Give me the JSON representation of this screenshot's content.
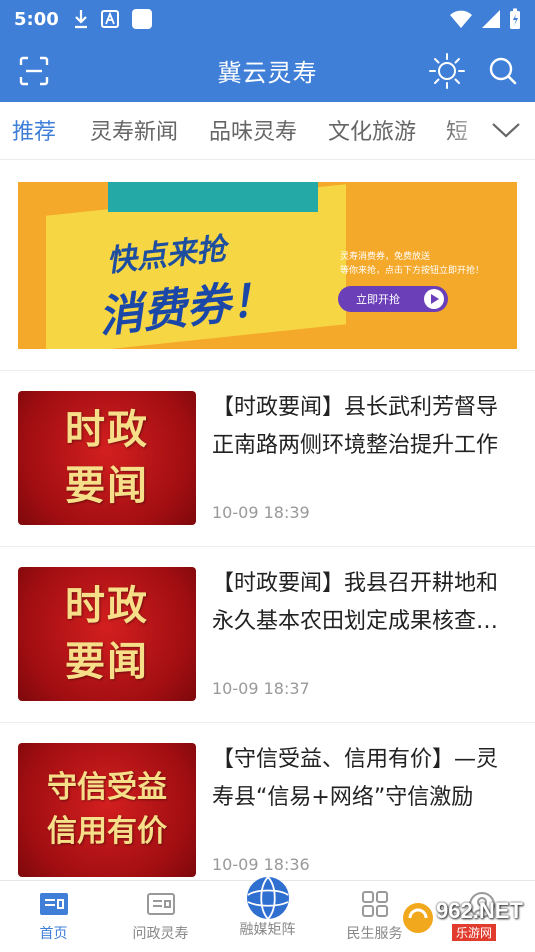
{
  "status_bar": {
    "time": "5:00"
  },
  "app_bar": {
    "title": "冀云灵寿"
  },
  "tabs": [
    {
      "label": "推荐",
      "active": true
    },
    {
      "label": "灵寿新闻",
      "active": false
    },
    {
      "label": "品味灵寿",
      "active": false
    },
    {
      "label": "文化旅游",
      "active": false
    },
    {
      "label": "短",
      "active": false
    }
  ],
  "banner": {
    "line1": "快点来抢",
    "line2": "消费券！",
    "note": "灵寿消费券，免费放送\n等你来抢，点击下方按钮立即开抢！",
    "button": "立即开抢"
  },
  "news": [
    {
      "thumb_lines": [
        "时政",
        "要闻"
      ],
      "title": "【时政要闻】县长武利芳督导正南路两侧环境整治提升工作",
      "time": "10-09 18:39"
    },
    {
      "thumb_lines": [
        "时政",
        "要闻"
      ],
      "title": "【时政要闻】我县召开耕地和永久基本农田划定成果核查工作",
      "time": "10-09 18:37"
    },
    {
      "thumb_lines": [
        "守信受益",
        "信用有价"
      ],
      "title": "【守信受益、信用有价】—灵寿县“信易+网络”守信激励",
      "time": "10-09 18:36"
    }
  ],
  "bottom_nav": [
    {
      "label": "首页",
      "icon": "home-news-icon",
      "active": true
    },
    {
      "label": "问政灵寿",
      "icon": "inquiry-icon",
      "active": false
    },
    {
      "label": "融媒矩阵",
      "icon": "globe-icon",
      "active": false
    },
    {
      "label": "民生服务",
      "icon": "grid-services-icon",
      "active": false
    },
    {
      "label": "我的",
      "icon": "user-icon",
      "active": false
    }
  ],
  "watermark": {
    "text": "962.NET",
    "sub": "乐游网"
  },
  "colors": {
    "brand": "#3f7fd8",
    "thumb_red": "#b8141a",
    "banner_orange": "#f5a92a"
  }
}
